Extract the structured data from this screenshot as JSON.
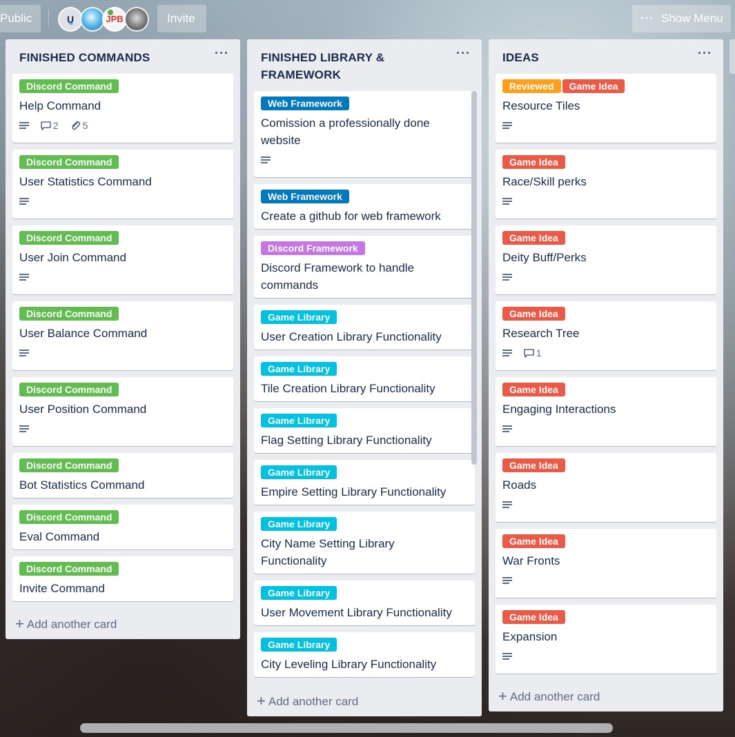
{
  "header": {
    "visibility_label": "Public",
    "invite_label": "Invite",
    "show_menu_label": "Show Menu",
    "members": [
      {
        "initials": "U",
        "sub": "≈"
      },
      {
        "initials": ""
      },
      {
        "initials": "JPB"
      },
      {
        "initials": ""
      }
    ]
  },
  "colors": {
    "green": "#61bd4f",
    "blue": "#0079bf",
    "purple": "#c377e0",
    "sky": "#00c2e0",
    "orange": "#ff9f1a",
    "red": "#eb5a46"
  },
  "lists": [
    {
      "title": "FINISHED COMMANDS",
      "add_card_label": "Add another card",
      "cards": [
        {
          "labels": [
            "Discord Command"
          ],
          "title": "Help Command",
          "comments": "2",
          "attachments": "5"
        },
        {
          "labels": [
            "Discord Command"
          ],
          "title": "User Statistics Command"
        },
        {
          "labels": [
            "Discord Command"
          ],
          "title": "User Join Command"
        },
        {
          "labels": [
            "Discord Command"
          ],
          "title": "User Balance Command"
        },
        {
          "labels": [
            "Discord Command"
          ],
          "title": "User Position Command"
        },
        {
          "labels": [
            "Discord Command"
          ],
          "title": "Bot Statistics Command"
        },
        {
          "labels": [
            "Discord Command"
          ],
          "title": "Eval Command"
        },
        {
          "labels": [
            "Discord Command"
          ],
          "title": "Invite Command"
        }
      ]
    },
    {
      "title_line1": "FINISHED LIBRARY &",
      "title_line2": "FRAMEWORK",
      "add_card_label": "Add another card",
      "cards": [
        {
          "labels": [
            "Web Framework"
          ],
          "title_line1": "Comission a professionally done",
          "title_line2": "website"
        },
        {
          "labels": [
            "Web Framework"
          ],
          "title": "Create a github for web framework"
        },
        {
          "labels": [
            "Discord Framework"
          ],
          "title_line1": "Discord Framework to handle",
          "title_line2": "commands"
        },
        {
          "labels": [
            "Game Library"
          ],
          "title": "User Creation Library Functionality"
        },
        {
          "labels": [
            "Game Library"
          ],
          "title": "Tile Creation Library Functionality"
        },
        {
          "labels": [
            "Game Library"
          ],
          "title": "Flag Setting Library Functionality"
        },
        {
          "labels": [
            "Game Library"
          ],
          "title": "Empire Setting Library Functionality"
        },
        {
          "labels": [
            "Game Library"
          ],
          "title_line1": "City Name Setting Library",
          "title_line2": "Functionality"
        },
        {
          "labels": [
            "Game Library"
          ],
          "title": "User Movement Library Functionality"
        },
        {
          "labels": [
            "Game Library"
          ],
          "title": "City Leveling Library Functionality"
        }
      ]
    },
    {
      "title": "IDEAS",
      "add_card_label": "Add another card",
      "cards": [
        {
          "labels": [
            "Reviewed",
            "Game Idea"
          ],
          "title": "Resource Tiles"
        },
        {
          "labels": [
            "Game Idea"
          ],
          "title": "Race/Skill perks"
        },
        {
          "labels": [
            "Game Idea"
          ],
          "title": "Deity Buff/Perks"
        },
        {
          "labels": [
            "Game Idea"
          ],
          "title": "Research Tree",
          "comments": "1"
        },
        {
          "labels": [
            "Game Idea"
          ],
          "title": "Engaging Interactions"
        },
        {
          "labels": [
            "Game Idea"
          ],
          "title": "Roads"
        },
        {
          "labels": [
            "Game Idea"
          ],
          "title": "War Fronts"
        },
        {
          "labels": [
            "Game Idea"
          ],
          "title": "Expansion"
        }
      ]
    }
  ]
}
